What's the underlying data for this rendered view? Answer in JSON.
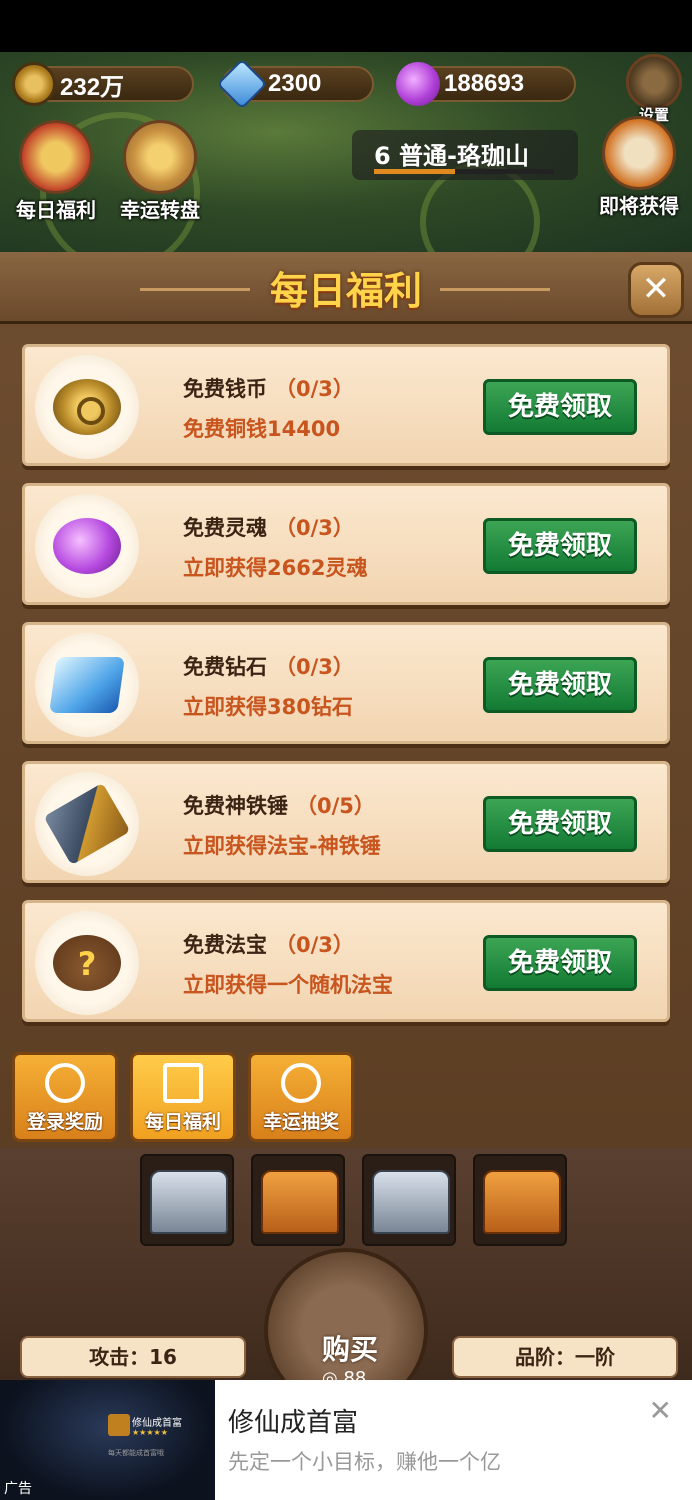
{
  "resources": {
    "coins": "232万",
    "diamonds": "2300",
    "souls": "188693"
  },
  "top_buttons": {
    "settings": "设置",
    "daily": "每日福利",
    "lucky": "幸运转盘",
    "upcoming": "即将获得"
  },
  "stage": {
    "label": "6 普通-珞珈山",
    "progress": 0.45
  },
  "panel": {
    "title": "每日福利",
    "claim_label": "免费领取",
    "items": [
      {
        "name": "免费钱币",
        "count": "（0/3）",
        "desc": "免费铜钱14400",
        "icon": "coin-icon"
      },
      {
        "name": "免费灵魂",
        "count": "（0/3）",
        "desc": "立即获得2662灵魂",
        "icon": "soul-icon"
      },
      {
        "name": "免费钻石",
        "count": "（0/3）",
        "desc": "立即获得380钻石",
        "icon": "diamond-icon"
      },
      {
        "name": "免费神铁锤",
        "count": "（0/5）",
        "desc": "立即获得法宝-神铁锤",
        "icon": "hammer-icon"
      },
      {
        "name": "免费法宝",
        "count": "（0/3）",
        "desc": "立即获得一个随机法宝",
        "icon": "mystery-gourd-icon"
      }
    ]
  },
  "tabs": [
    {
      "label": "登录奖励",
      "icon": "person-icon"
    },
    {
      "label": "每日福利",
      "icon": "gift-icon"
    },
    {
      "label": "幸运抽奖",
      "icon": "wheel-icon"
    }
  ],
  "bottom": {
    "buy_label": "购买",
    "buy_price": "88",
    "attack": "攻击：16",
    "grade": "品阶：一阶"
  },
  "ad": {
    "title": "修仙成首富",
    "desc": "先定一个小目标，赚他一个亿",
    "tag": "广告",
    "thumb_name": "修仙成首富",
    "thumb_stars": "★★★★★",
    "thumb_sub": "每天都能成首富哦",
    "close": "✕"
  }
}
